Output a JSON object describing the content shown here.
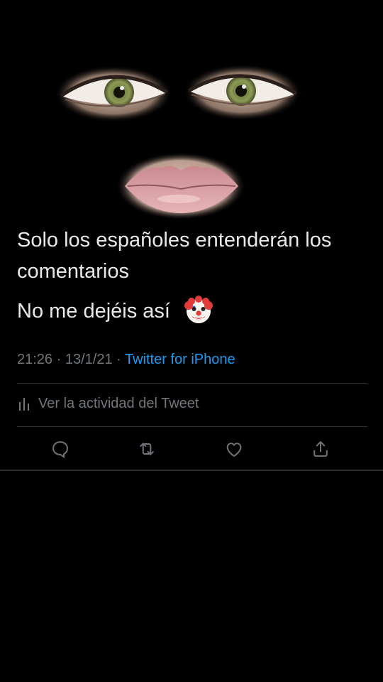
{
  "tweet": {
    "text_line_1": "Solo los españoles entenderán los comentarios",
    "text_line_2": "No me dejéis así",
    "emoji": "clown-face-emoji",
    "time": "21:26",
    "separator": "·",
    "date": "13/1/21",
    "source": "Twitter for iPhone"
  },
  "activity": {
    "label": "Ver la actividad del Tweet",
    "icon": "bar-chart-icon"
  },
  "actions": [
    {
      "name": "reply",
      "icon": "comment-icon"
    },
    {
      "name": "retweet",
      "icon": "retweet-icon"
    },
    {
      "name": "like",
      "icon": "heart-icon"
    },
    {
      "name": "share",
      "icon": "share-icon"
    }
  ],
  "colors": {
    "background": "#000000",
    "text": "#e7e9ea",
    "secondary": "#71767b",
    "link": "#1d9bf0",
    "divider": "#2f3336"
  }
}
